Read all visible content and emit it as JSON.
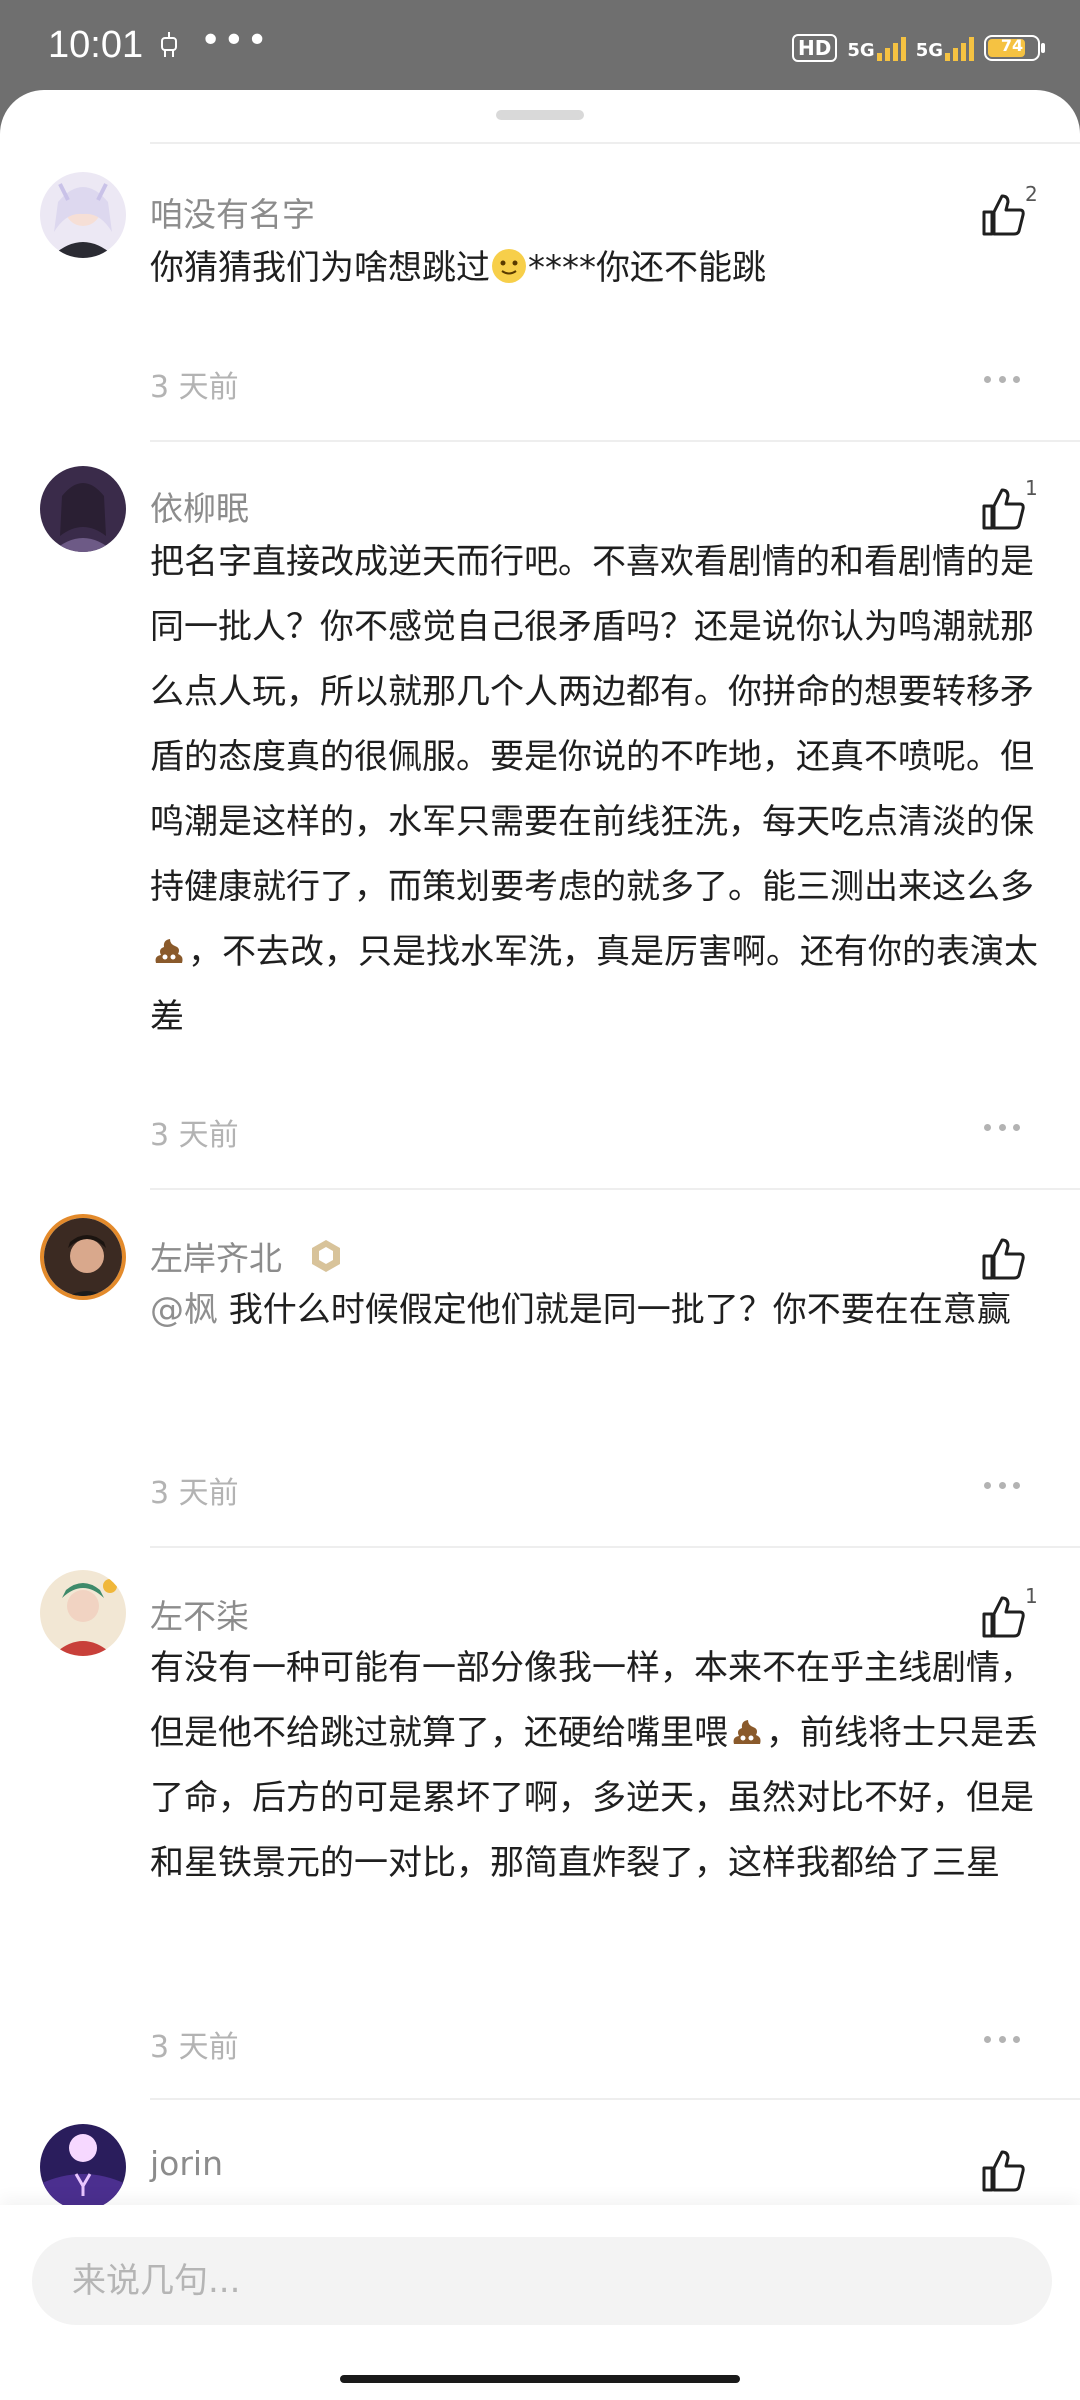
{
  "status_bar": {
    "time": "10:01",
    "dots": "•••",
    "hd": "HD",
    "net1": "5G",
    "net2": "5G",
    "battery": "74"
  },
  "comments": [
    {
      "username": "咱没有名字",
      "likes": "2",
      "time": "3 天前",
      "text_before": "你猜猜我们为啥想跳过",
      "text_after": "****你还不能跳"
    },
    {
      "username": "依柳眠",
      "likes": "1",
      "time": "3 天前",
      "text_before": "把名字直接改成逆天而行吧。不喜欢看剧情的和看剧情的是同一批人？你不感觉自己很矛盾吗？还是说你认为鸣潮就那么点人玩，所以就那几个人两边都有。你拼命的想要转移矛盾的态度真的很佩服。要是你说的不咋地，还真不喷呢。但鸣潮是这样的，水军只需要在前线狂洗，每天吃点清淡的保持健康就行了，而策划要考虑的就多了。能三测出来这么多",
      "text_after": "，不去改，只是找水军洗，真是厉害啊。还有你的表演太差"
    },
    {
      "username": "左岸齐北",
      "likes": "",
      "time": "3 天前",
      "mention": "@枫",
      "text": "  我什么时候假定他们就是同一批了？你不要在在意赢"
    },
    {
      "username": "左不柒",
      "likes": "1",
      "time": "3 天前",
      "text_before": "有没有一种可能有一部分像我一样，本来不在乎主线剧情，但是他不给跳过就算了，还硬给嘴里喂",
      "text_after": "，前线将士只是丢了命，后方的可是累坏了啊，多逆天，虽然对比不好，但是和星铁景元的一对比，那简直炸裂了，这样我都给了三星"
    },
    {
      "username": "jorin",
      "likes": ""
    }
  ],
  "input": {
    "placeholder": "来说几句..."
  },
  "colors": {
    "username": "#8c8c8c",
    "text": "#1f1f1f",
    "time": "#b3b3b3",
    "divider": "#eeeeee"
  }
}
